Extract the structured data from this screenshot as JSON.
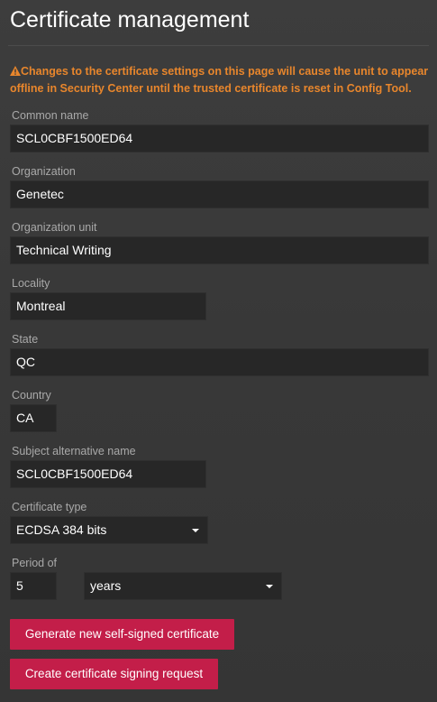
{
  "page": {
    "title": "Certificate management",
    "warning": "Changes to the certificate settings on this page will cause the unit to appear offline in Security Center until the trusted certificate is reset in Config Tool."
  },
  "form": {
    "common_name": {
      "label": "Common name",
      "value": "SCL0CBF1500ED64"
    },
    "organization": {
      "label": "Organization",
      "value": "Genetec"
    },
    "organization_unit": {
      "label": "Organization unit",
      "value": "Technical Writing"
    },
    "locality": {
      "label": "Locality",
      "value": "Montreal"
    },
    "state": {
      "label": "State",
      "value": "QC"
    },
    "country": {
      "label": "Country",
      "value": "CA"
    },
    "subject_alternative_name": {
      "label": "Subject alternative name",
      "value": "SCL0CBF1500ED64"
    },
    "certificate_type": {
      "label": "Certificate type",
      "value": "ECDSA 384 bits"
    },
    "period": {
      "label": "Period of",
      "value": "5",
      "unit": "years"
    }
  },
  "actions": {
    "generate_label": "Generate new self-signed certificate",
    "csr_label": "Create certificate signing request"
  },
  "colors": {
    "accent": "#c31e49",
    "warning": "#e8862c",
    "background": "#3a3a3a",
    "field_background": "#272727",
    "label": "#a9a9a9"
  },
  "icons": {
    "warning": "warning-triangle-icon",
    "dropdown": "chevron-down-icon"
  }
}
